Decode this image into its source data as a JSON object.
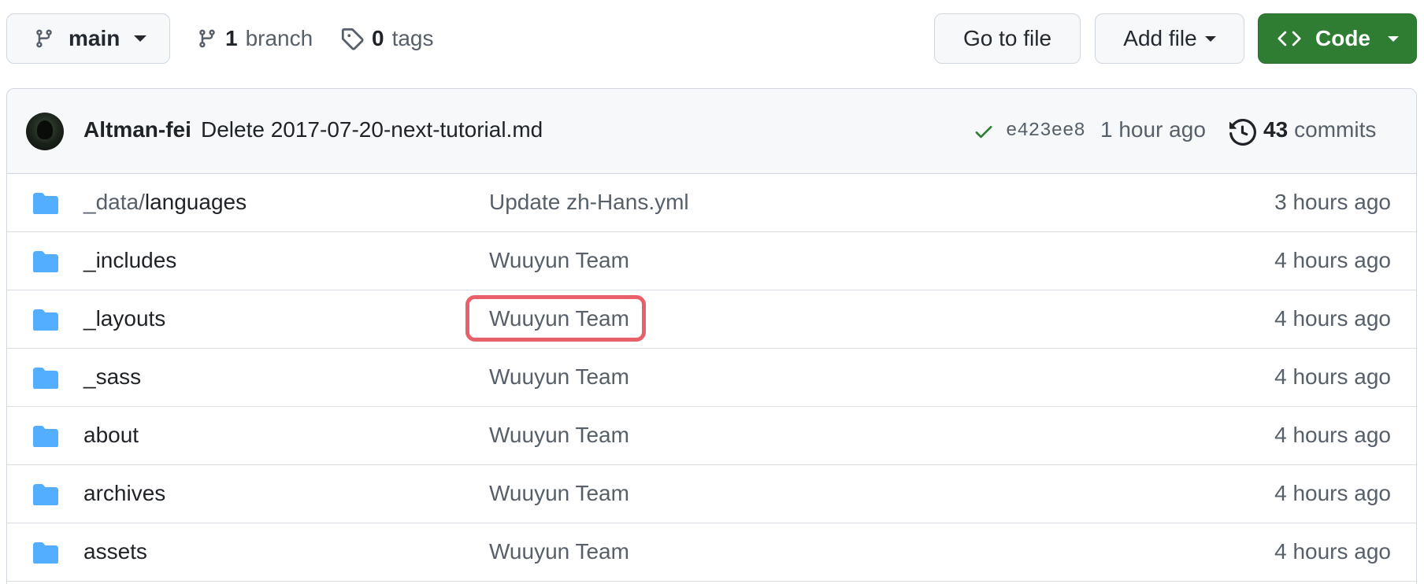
{
  "toolbar": {
    "branch_name": "main",
    "branch_count": "1",
    "branch_label": "branch",
    "tag_count": "0",
    "tag_label": "tags",
    "go_to_file": "Go to file",
    "add_file": "Add file",
    "code": "Code"
  },
  "commit": {
    "author": "Altman-fei",
    "message": "Delete 2017-07-20-next-tutorial.md",
    "sha": "e423ee8",
    "time": "1 hour ago",
    "count": "43",
    "count_label": "commits"
  },
  "files": [
    {
      "dir": "_data/",
      "name": "languages",
      "message": "Update zh-Hans.yml",
      "age": "3 hours ago"
    },
    {
      "dir": "",
      "name": "_includes",
      "message": "Wuuyun Team",
      "age": "4 hours ago"
    },
    {
      "dir": "",
      "name": "_layouts",
      "message": "Wuuyun Team",
      "age": "4 hours ago"
    },
    {
      "dir": "",
      "name": "_sass",
      "message": "Wuuyun Team",
      "age": "4 hours ago"
    },
    {
      "dir": "",
      "name": "about",
      "message": "Wuuyun Team",
      "age": "4 hours ago"
    },
    {
      "dir": "",
      "name": "archives",
      "message": "Wuuyun Team",
      "age": "4 hours ago"
    },
    {
      "dir": "",
      "name": "assets",
      "message": "Wuuyun Team",
      "age": "4 hours ago"
    }
  ],
  "colors": {
    "code_button": "#2e7d32",
    "folder": "#54aeff",
    "highlight": "#e8606a",
    "check": "#2e7d32"
  }
}
